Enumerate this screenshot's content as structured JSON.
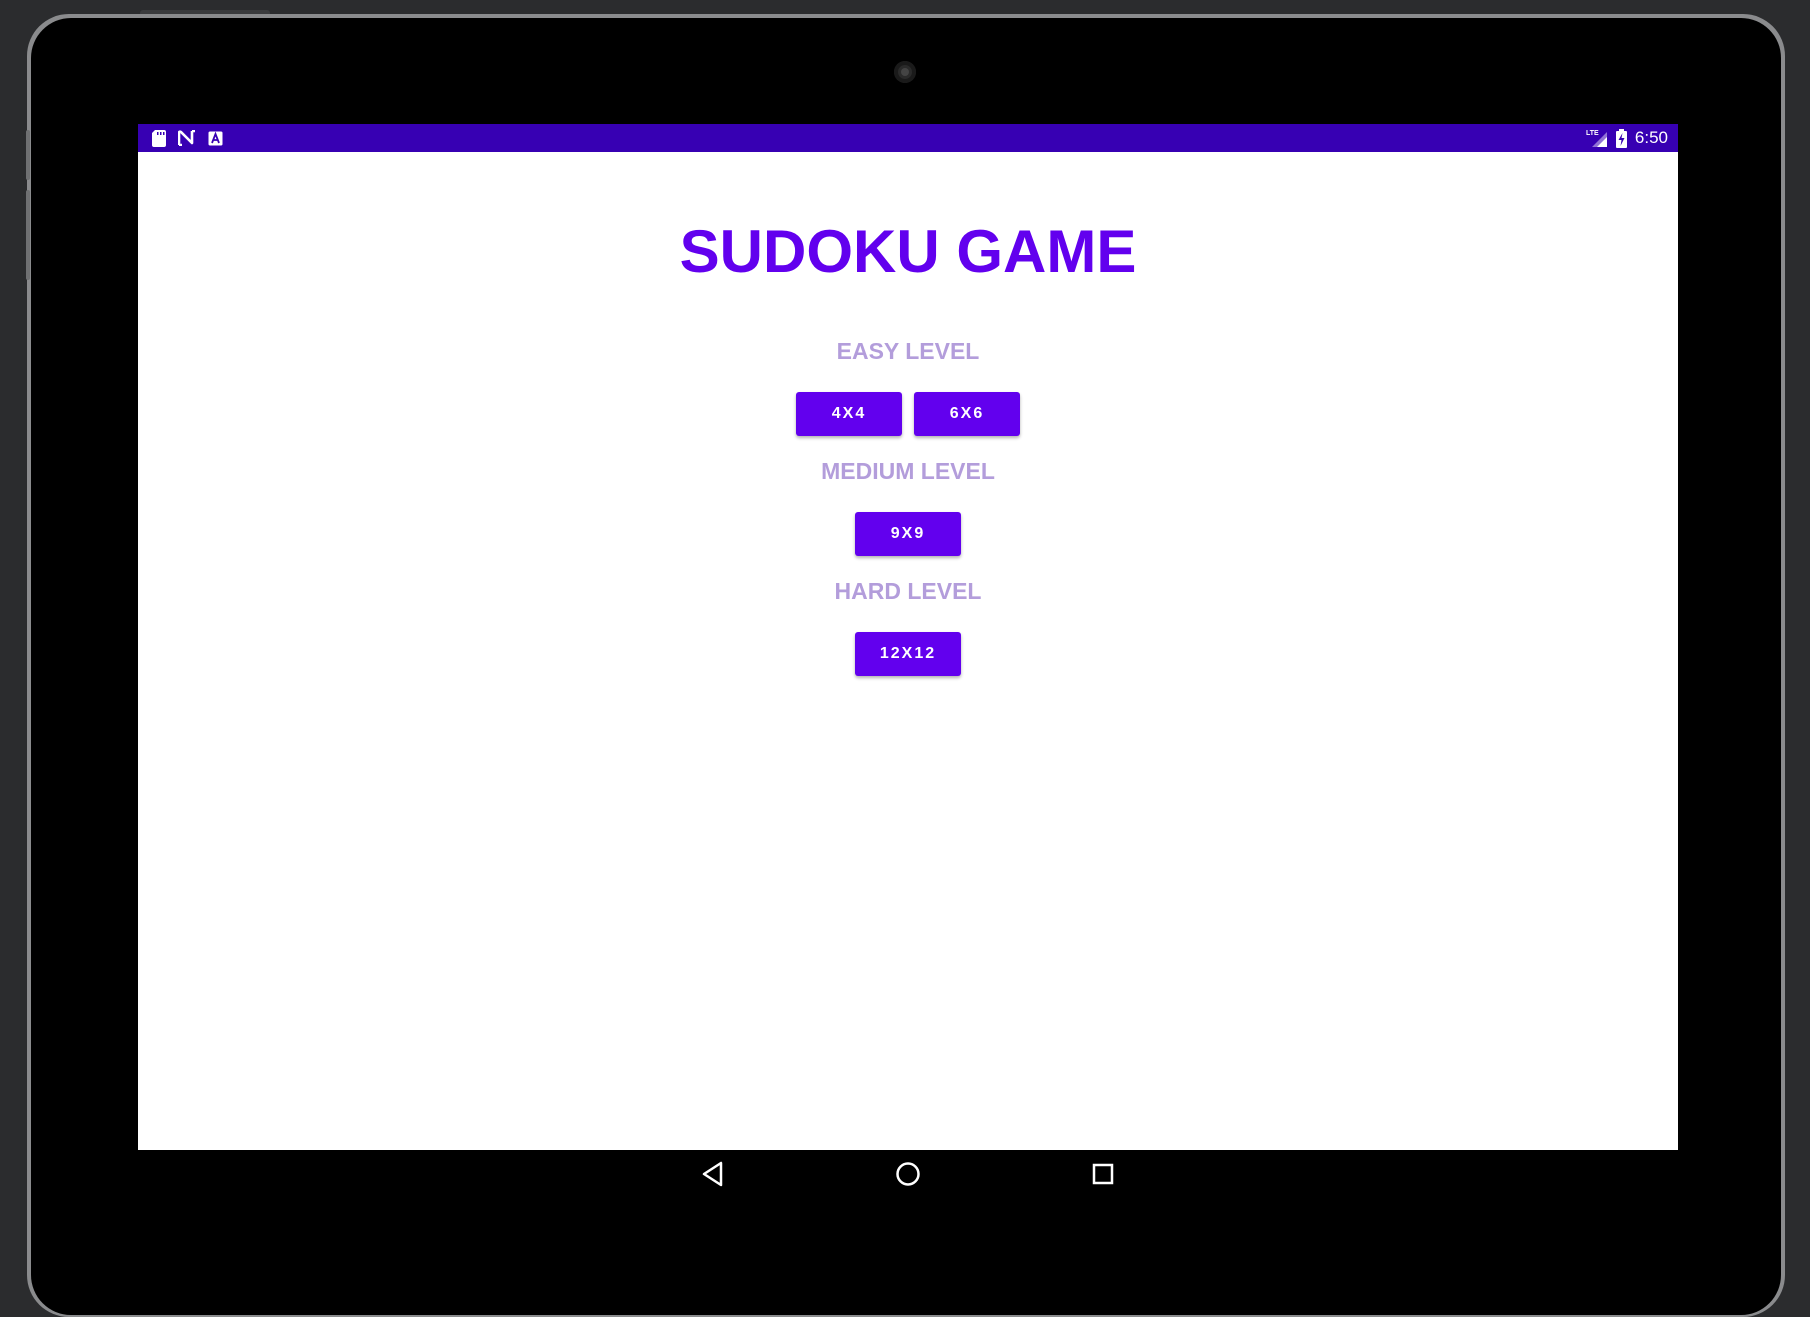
{
  "status_bar": {
    "time": "6:50",
    "left_icons": [
      "sd-card-icon",
      "n-notification-icon",
      "a-notification-icon"
    ],
    "right_icons": [
      "lte-signal-icon",
      "battery-charging-icon"
    ],
    "network": "LTE",
    "color": "#3700b3"
  },
  "app": {
    "title": "SUDOKU GAME",
    "accent_color": "#6200ee",
    "label_color": "#b39ddb"
  },
  "levels": {
    "easy": {
      "label": "EASY LEVEL",
      "buttons": [
        "4X4",
        "6X6"
      ]
    },
    "medium": {
      "label": "MEDIUM LEVEL",
      "buttons": [
        "9X9"
      ]
    },
    "hard": {
      "label": "HARD LEVEL",
      "buttons": [
        "12X12"
      ]
    }
  },
  "nav_bar": {
    "icons": [
      "back-icon",
      "home-icon",
      "recents-icon"
    ]
  }
}
